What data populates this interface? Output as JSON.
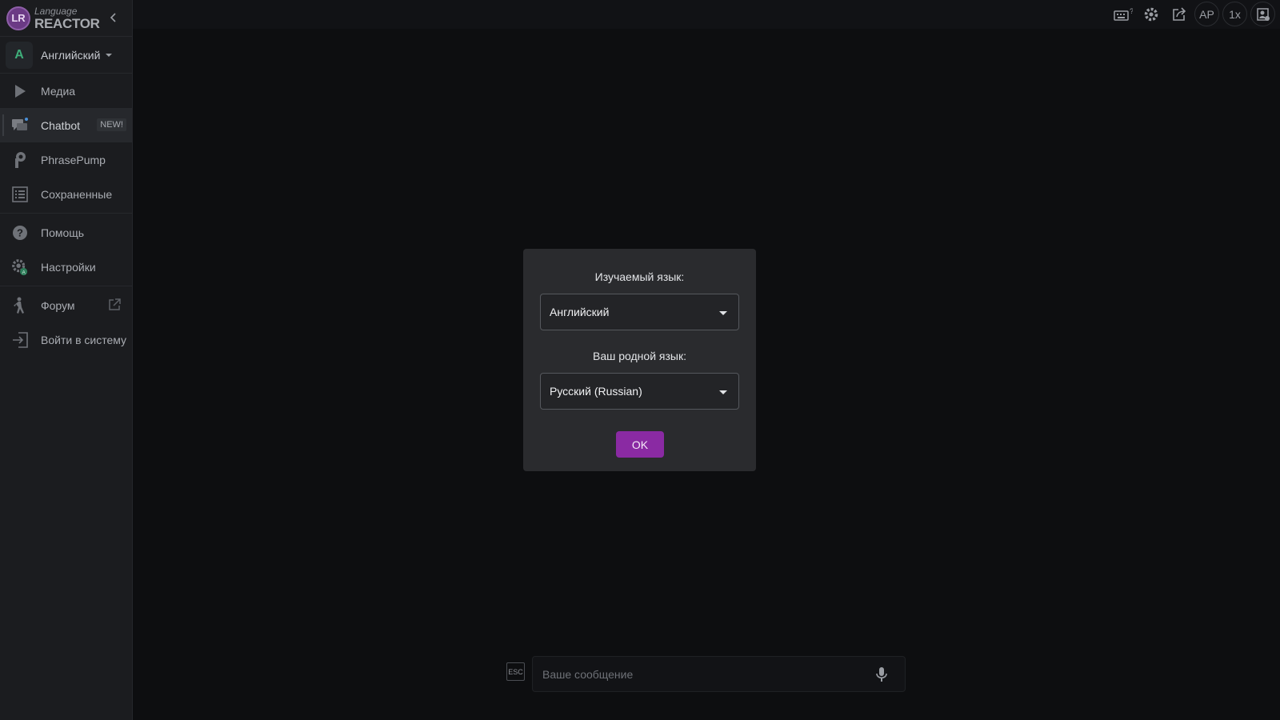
{
  "app": {
    "logo_initials": "LR",
    "logo_small": "Language",
    "logo_big": "REACTOR"
  },
  "language_selector": {
    "avatar": "A",
    "name": "Английский"
  },
  "nav": {
    "media": "Медиа",
    "chatbot": "Chatbot",
    "chatbot_badge": "NEW!",
    "phrasepump": "PhrasePump",
    "saved": "Сохраненные",
    "help": "Помощь",
    "settings": "Настройки",
    "forum": "Форум",
    "login": "Войти в систему"
  },
  "topbar": {
    "ap_label": "AP",
    "speed_label": "1x"
  },
  "modal": {
    "target_label": "Изучаемый язык:",
    "target_value": "Английский",
    "native_label": "Ваш родной язык:",
    "native_value": "Русский (Russian)",
    "ok_label": "OK"
  },
  "chat": {
    "esc_label": "ESC",
    "placeholder": "Ваше сообщение"
  },
  "colors": {
    "accent": "#8a2aa3",
    "avatar_text": "#3fae7a"
  }
}
